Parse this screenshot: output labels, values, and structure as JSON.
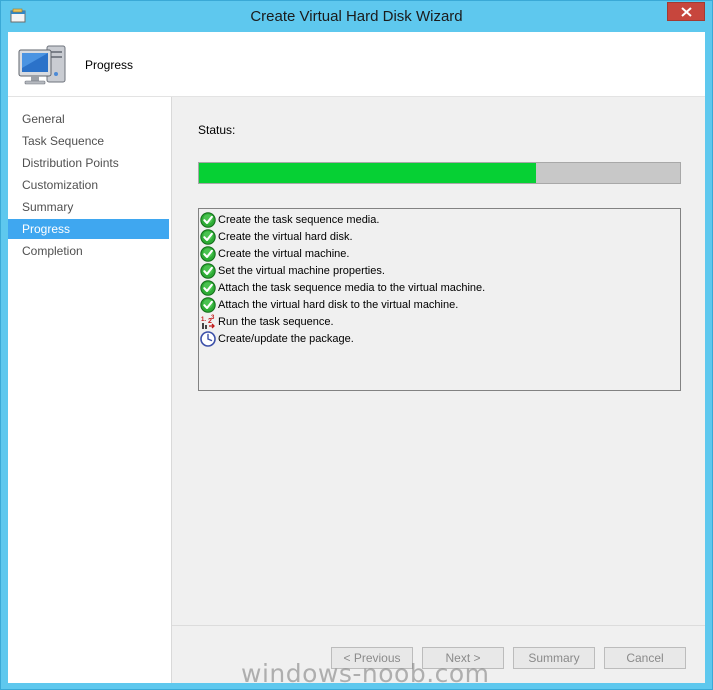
{
  "window": {
    "title": "Create Virtual Hard Disk Wizard"
  },
  "header": {
    "title": "Progress"
  },
  "nav": {
    "items": [
      {
        "label": "General",
        "selected": false
      },
      {
        "label": "Task Sequence",
        "selected": false
      },
      {
        "label": "Distribution Points",
        "selected": false
      },
      {
        "label": "Customization",
        "selected": false
      },
      {
        "label": "Summary",
        "selected": false
      },
      {
        "label": "Progress",
        "selected": true
      },
      {
        "label": "Completion",
        "selected": false
      }
    ]
  },
  "content": {
    "status_label": "Status:",
    "progress_fraction": 0.7,
    "steps": [
      {
        "text": "Create the task sequence media.",
        "state": "done",
        "icon": "checkmark-icon"
      },
      {
        "text": "Create the virtual hard disk.",
        "state": "done",
        "icon": "checkmark-icon"
      },
      {
        "text": "Create the virtual machine.",
        "state": "done",
        "icon": "checkmark-icon"
      },
      {
        "text": "Set the virtual machine properties.",
        "state": "done",
        "icon": "checkmark-icon"
      },
      {
        "text": "Attach the task sequence media to the virtual machine.",
        "state": "done",
        "icon": "checkmark-icon"
      },
      {
        "text": "Attach the virtual hard disk to the virtual machine.",
        "state": "done",
        "icon": "checkmark-icon"
      },
      {
        "text": "Run the task sequence.",
        "state": "running",
        "icon": "task-sequence-icon"
      },
      {
        "text": "Create/update the package.",
        "state": "pending",
        "icon": "clock-icon"
      }
    ]
  },
  "buttons": {
    "previous": "< Previous",
    "next": "Next >",
    "summary": "Summary",
    "cancel": "Cancel"
  },
  "watermark": "windows-noob.com",
  "colors": {
    "title_bar": "#5ec8ee",
    "progress_fill": "#06d034",
    "nav_selected": "#3fa7f0",
    "close_button": "#c7463d"
  }
}
